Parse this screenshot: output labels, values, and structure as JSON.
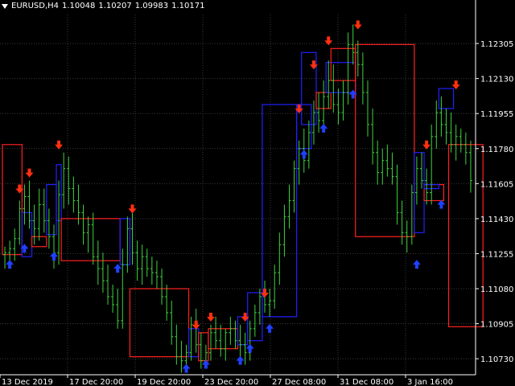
{
  "header": {
    "symbol": "EURUSD,H4",
    "open": "1.10048",
    "high": "1.10207",
    "low": "1.09983",
    "close": "1.10171"
  },
  "colors": {
    "background": "#000000",
    "grid": "#3a3a3a",
    "axis": "#ffffff",
    "bar": "#3fd33f",
    "box_up": "#2020ff",
    "box_down": "#ff2020",
    "arrow_up": "#2040ff",
    "arrow_down": "#ff3010"
  },
  "icons": {
    "menu": "triangle-down-icon",
    "buy": "up-arrow-icon",
    "sell": "down-arrow-icon"
  },
  "chart_data": {
    "type": "ohlc",
    "ylim": [
      1.1065,
      1.1245
    ],
    "y_ticks": [
      "1.12305",
      "1.12130",
      "1.11955",
      "1.11780",
      "1.11605",
      "1.11430",
      "1.11255",
      "1.11080",
      "1.10905",
      "1.10730"
    ],
    "x_ticks": [
      "13 Dec 2019",
      "17 Dec 20:00",
      "19 Dec 20:00",
      "23 Dec 20:00",
      "27 Dec 08:00",
      "31 Dec 08:00",
      "3 Jan 16:00"
    ],
    "series": [
      {
        "name": "price",
        "values": [
          [
            1.1125,
            1.1129,
            1.1118,
            1.1126
          ],
          [
            1.1126,
            1.1132,
            1.112,
            1.1128
          ],
          [
            1.1128,
            1.1138,
            1.1122,
            1.1133
          ],
          [
            1.1133,
            1.1152,
            1.113,
            1.1148
          ],
          [
            1.1148,
            1.116,
            1.114,
            1.1154
          ],
          [
            1.1154,
            1.1162,
            1.1138,
            1.1142
          ],
          [
            1.1142,
            1.115,
            1.113,
            1.1138
          ],
          [
            1.1138,
            1.1158,
            1.1132,
            1.115
          ],
          [
            1.115,
            1.1158,
            1.1136,
            1.1142
          ],
          [
            1.1142,
            1.1148,
            1.1128,
            1.1134
          ],
          [
            1.1134,
            1.114,
            1.1118,
            1.1126
          ],
          [
            1.1126,
            1.1162,
            1.112,
            1.1155
          ],
          [
            1.1155,
            1.1176,
            1.1148,
            1.1168
          ],
          [
            1.1168,
            1.1174,
            1.115,
            1.1158
          ],
          [
            1.1158,
            1.1164,
            1.1146,
            1.1152
          ],
          [
            1.1152,
            1.116,
            1.114,
            1.1146
          ],
          [
            1.1146,
            1.115,
            1.113,
            1.1136
          ],
          [
            1.1136,
            1.1144,
            1.1126,
            1.114
          ],
          [
            1.114,
            1.1146,
            1.112,
            1.1124
          ],
          [
            1.1124,
            1.1132,
            1.111,
            1.1118
          ],
          [
            1.1118,
            1.1126,
            1.1106,
            1.1112
          ],
          [
            1.1112,
            1.112,
            1.11,
            1.1104
          ],
          [
            1.1104,
            1.111,
            1.1096,
            1.11
          ],
          [
            1.11,
            1.1108,
            1.1088,
            1.1092
          ],
          [
            1.1092,
            1.1128,
            1.1088,
            1.112
          ],
          [
            1.112,
            1.1144,
            1.1116,
            1.1138
          ],
          [
            1.1138,
            1.1146,
            1.112,
            1.1126
          ],
          [
            1.1126,
            1.1132,
            1.1112,
            1.1118
          ],
          [
            1.1118,
            1.113,
            1.111,
            1.1124
          ],
          [
            1.1124,
            1.1128,
            1.1114,
            1.1118
          ],
          [
            1.1118,
            1.1124,
            1.111,
            1.1116
          ],
          [
            1.1116,
            1.1122,
            1.1108,
            1.1114
          ],
          [
            1.1114,
            1.1118,
            1.11,
            1.1104
          ],
          [
            1.1104,
            1.111,
            1.1092,
            1.1096
          ],
          [
            1.1096,
            1.1102,
            1.108,
            1.1084
          ],
          [
            1.1084,
            1.109,
            1.107,
            1.1074
          ],
          [
            1.1074,
            1.1082,
            1.1066,
            1.1072
          ],
          [
            1.1072,
            1.108,
            1.1068,
            1.1076
          ],
          [
            1.1076,
            1.1094,
            1.1072,
            1.109
          ],
          [
            1.109,
            1.1098,
            1.1076,
            1.108
          ],
          [
            1.108,
            1.1086,
            1.1068,
            1.1072
          ],
          [
            1.1072,
            1.108,
            1.1068,
            1.1076
          ],
          [
            1.1076,
            1.109,
            1.1072,
            1.1086
          ],
          [
            1.1086,
            1.1094,
            1.1078,
            1.1082
          ],
          [
            1.1082,
            1.109,
            1.1074,
            1.1078
          ],
          [
            1.1078,
            1.1088,
            1.1072,
            1.1086
          ],
          [
            1.1086,
            1.1094,
            1.108,
            1.1088
          ],
          [
            1.1088,
            1.1092,
            1.1078,
            1.1082
          ],
          [
            1.1082,
            1.109,
            1.1074,
            1.108
          ],
          [
            1.108,
            1.1086,
            1.107,
            1.1076
          ],
          [
            1.1076,
            1.1092,
            1.1072,
            1.1088
          ],
          [
            1.1088,
            1.11,
            1.1084,
            1.1096
          ],
          [
            1.1096,
            1.1108,
            1.109,
            1.1104
          ],
          [
            1.1104,
            1.1112,
            1.1096,
            1.11
          ],
          [
            1.11,
            1.1108,
            1.1094,
            1.1102
          ],
          [
            1.1102,
            1.112,
            1.1098,
            1.1116
          ],
          [
            1.1116,
            1.1136,
            1.111,
            1.113
          ],
          [
            1.113,
            1.115,
            1.1124,
            1.1144
          ],
          [
            1.1144,
            1.116,
            1.1138,
            1.1152
          ],
          [
            1.1152,
            1.1172,
            1.1146,
            1.1168
          ],
          [
            1.1168,
            1.1182,
            1.116,
            1.1178
          ],
          [
            1.1178,
            1.1188,
            1.1166,
            1.1172
          ],
          [
            1.1172,
            1.1192,
            1.1168,
            1.1186
          ],
          [
            1.1186,
            1.1202,
            1.118,
            1.1196
          ],
          [
            1.1196,
            1.1206,
            1.1186,
            1.1192
          ],
          [
            1.1192,
            1.1212,
            1.1188,
            1.1204
          ],
          [
            1.1204,
            1.1222,
            1.1198,
            1.1212
          ],
          [
            1.1212,
            1.122,
            1.1196,
            1.12
          ],
          [
            1.12,
            1.1208,
            1.119,
            1.1196
          ],
          [
            1.1196,
            1.1212,
            1.1192,
            1.1206
          ],
          [
            1.1206,
            1.1236,
            1.12,
            1.123
          ],
          [
            1.123,
            1.124,
            1.122,
            1.1226
          ],
          [
            1.1226,
            1.1232,
            1.1214,
            1.122
          ],
          [
            1.122,
            1.1226,
            1.12,
            1.1206
          ],
          [
            1.1206,
            1.1212,
            1.1184,
            1.119
          ],
          [
            1.119,
            1.1198,
            1.117,
            1.1176
          ],
          [
            1.1176,
            1.1182,
            1.116,
            1.1166
          ],
          [
            1.1166,
            1.1178,
            1.116,
            1.1172
          ],
          [
            1.1172,
            1.118,
            1.1164,
            1.1168
          ],
          [
            1.1168,
            1.1176,
            1.116,
            1.1164
          ],
          [
            1.1164,
            1.117,
            1.114,
            1.1146
          ],
          [
            1.1146,
            1.1152,
            1.113,
            1.1136
          ],
          [
            1.1136,
            1.1142,
            1.1126,
            1.1134
          ],
          [
            1.1134,
            1.116,
            1.113,
            1.1156
          ],
          [
            1.1156,
            1.1174,
            1.115,
            1.1168
          ],
          [
            1.1168,
            1.1176,
            1.1158,
            1.1162
          ],
          [
            1.1162,
            1.1168,
            1.115,
            1.1156
          ],
          [
            1.1156,
            1.119,
            1.115,
            1.1184
          ],
          [
            1.1184,
            1.1202,
            1.1178,
            1.1196
          ],
          [
            1.1196,
            1.1204,
            1.1184,
            1.119
          ],
          [
            1.119,
            1.1198,
            1.118,
            1.1186
          ],
          [
            1.1186,
            1.1196,
            1.1176,
            1.118
          ],
          [
            1.118,
            1.119,
            1.1172,
            1.1184
          ],
          [
            1.1184,
            1.1188,
            1.1176,
            1.118
          ],
          [
            1.118,
            1.1186,
            1.117,
            1.1176
          ],
          [
            1.1176,
            1.1182,
            1.1156,
            1.1162
          ]
        ]
      }
    ],
    "boxes": [
      {
        "color": "down",
        "x0": 0,
        "x1": 4,
        "y0": 1.1125,
        "y1": 1.118
      },
      {
        "color": "up",
        "x0": 4,
        "x1": 6,
        "y0": 1.1124,
        "y1": 1.1146
      },
      {
        "color": "down",
        "x0": 6,
        "x1": 9,
        "y0": 1.1129,
        "y1": 1.1134
      },
      {
        "color": "up",
        "x0": 9,
        "x1": 11,
        "y0": 1.1135,
        "y1": 1.116
      },
      {
        "color": "up",
        "x0": 11,
        "x1": 12,
        "y0": 1.1142,
        "y1": 1.117
      },
      {
        "color": "down",
        "x0": 12,
        "x1": 24,
        "y0": 1.1122,
        "y1": 1.1143
      },
      {
        "color": "up",
        "x0": 24,
        "x1": 26,
        "y0": 1.112,
        "y1": 1.1143
      },
      {
        "color": "down",
        "x0": 26,
        "x1": 38,
        "y0": 1.1074,
        "y1": 1.1108
      },
      {
        "color": "up",
        "x0": 38,
        "x1": 40,
        "y0": 1.1074,
        "y1": 1.1088
      },
      {
        "color": "down",
        "x0": 40,
        "x1": 42,
        "y0": 1.1072,
        "y1": 1.1086
      },
      {
        "color": "down",
        "x0": 42,
        "x1": 48,
        "y0": 1.1078,
        "y1": 1.1088
      },
      {
        "color": "up",
        "x0": 48,
        "x1": 50,
        "y0": 1.108,
        "y1": 1.1094
      },
      {
        "color": "up",
        "x0": 50,
        "x1": 53,
        "y0": 1.1082,
        "y1": 1.1106
      },
      {
        "color": "up",
        "x0": 53,
        "x1": 60,
        "y0": 1.1094,
        "y1": 1.12
      },
      {
        "color": "up",
        "x0": 60,
        "x1": 63,
        "y0": 1.1178,
        "y1": 1.12
      },
      {
        "color": "up",
        "x0": 61,
        "x1": 64,
        "y0": 1.119,
        "y1": 1.1226
      },
      {
        "color": "down",
        "x0": 64,
        "x1": 67,
        "y0": 1.1198,
        "y1": 1.1206
      },
      {
        "color": "up",
        "x0": 66,
        "x1": 72,
        "y0": 1.1206,
        "y1": 1.1221
      },
      {
        "color": "down",
        "x0": 67,
        "x1": 72,
        "y0": 1.1212,
        "y1": 1.1228
      },
      {
        "color": "down",
        "x0": 72,
        "x1": 84,
        "y0": 1.1134,
        "y1": 1.123
      },
      {
        "color": "up",
        "x0": 84,
        "x1": 86,
        "y0": 1.1136,
        "y1": 1.1176
      },
      {
        "color": "down",
        "x0": 86,
        "x1": 90,
        "y0": 1.1152,
        "y1": 1.116
      },
      {
        "color": "up",
        "x0": 86,
        "x1": 89,
        "y0": 1.1158,
        "y1": 1.116
      },
      {
        "color": "up",
        "x0": 89,
        "x1": 92,
        "y0": 1.1198,
        "y1": 1.1208
      },
      {
        "color": "down",
        "x0": 91,
        "x1": 98,
        "y0": 1.1089,
        "y1": 1.118
      }
    ],
    "arrows": [
      {
        "dir": "up",
        "i": 1,
        "y": 1.112
      },
      {
        "dir": "down",
        "i": 3,
        "y": 1.1158
      },
      {
        "dir": "up",
        "i": 4,
        "y": 1.1128
      },
      {
        "dir": "down",
        "i": 5,
        "y": 1.1166
      },
      {
        "dir": "up",
        "i": 10,
        "y": 1.1124
      },
      {
        "dir": "down",
        "i": 11,
        "y": 1.118
      },
      {
        "dir": "up",
        "i": 23,
        "y": 1.1118
      },
      {
        "dir": "down",
        "i": 26,
        "y": 1.1148
      },
      {
        "dir": "up",
        "i": 37,
        "y": 1.1068
      },
      {
        "dir": "down",
        "i": 39,
        "y": 1.109
      },
      {
        "dir": "up",
        "i": 41,
        "y": 1.107
      },
      {
        "dir": "down",
        "i": 42,
        "y": 1.1094
      },
      {
        "dir": "up",
        "i": 48,
        "y": 1.1072
      },
      {
        "dir": "down",
        "i": 49,
        "y": 1.1094
      },
      {
        "dir": "up",
        "i": 50,
        "y": 1.1078
      },
      {
        "dir": "down",
        "i": 53,
        "y": 1.1106
      },
      {
        "dir": "up",
        "i": 54,
        "y": 1.1088
      },
      {
        "dir": "down",
        "i": 60,
        "y": 1.1198
      },
      {
        "dir": "up",
        "i": 61,
        "y": 1.1175
      },
      {
        "dir": "down",
        "i": 63,
        "y": 1.122
      },
      {
        "dir": "up",
        "i": 65,
        "y": 1.1188
      },
      {
        "dir": "down",
        "i": 66,
        "y": 1.1232
      },
      {
        "dir": "up",
        "i": 71,
        "y": 1.1205
      },
      {
        "dir": "down",
        "i": 72,
        "y": 1.124
      },
      {
        "dir": "up",
        "i": 84,
        "y": 1.112
      },
      {
        "dir": "down",
        "i": 86,
        "y": 1.118
      },
      {
        "dir": "up",
        "i": 89,
        "y": 1.115
      },
      {
        "dir": "down",
        "i": 92,
        "y": 1.121
      }
    ]
  }
}
